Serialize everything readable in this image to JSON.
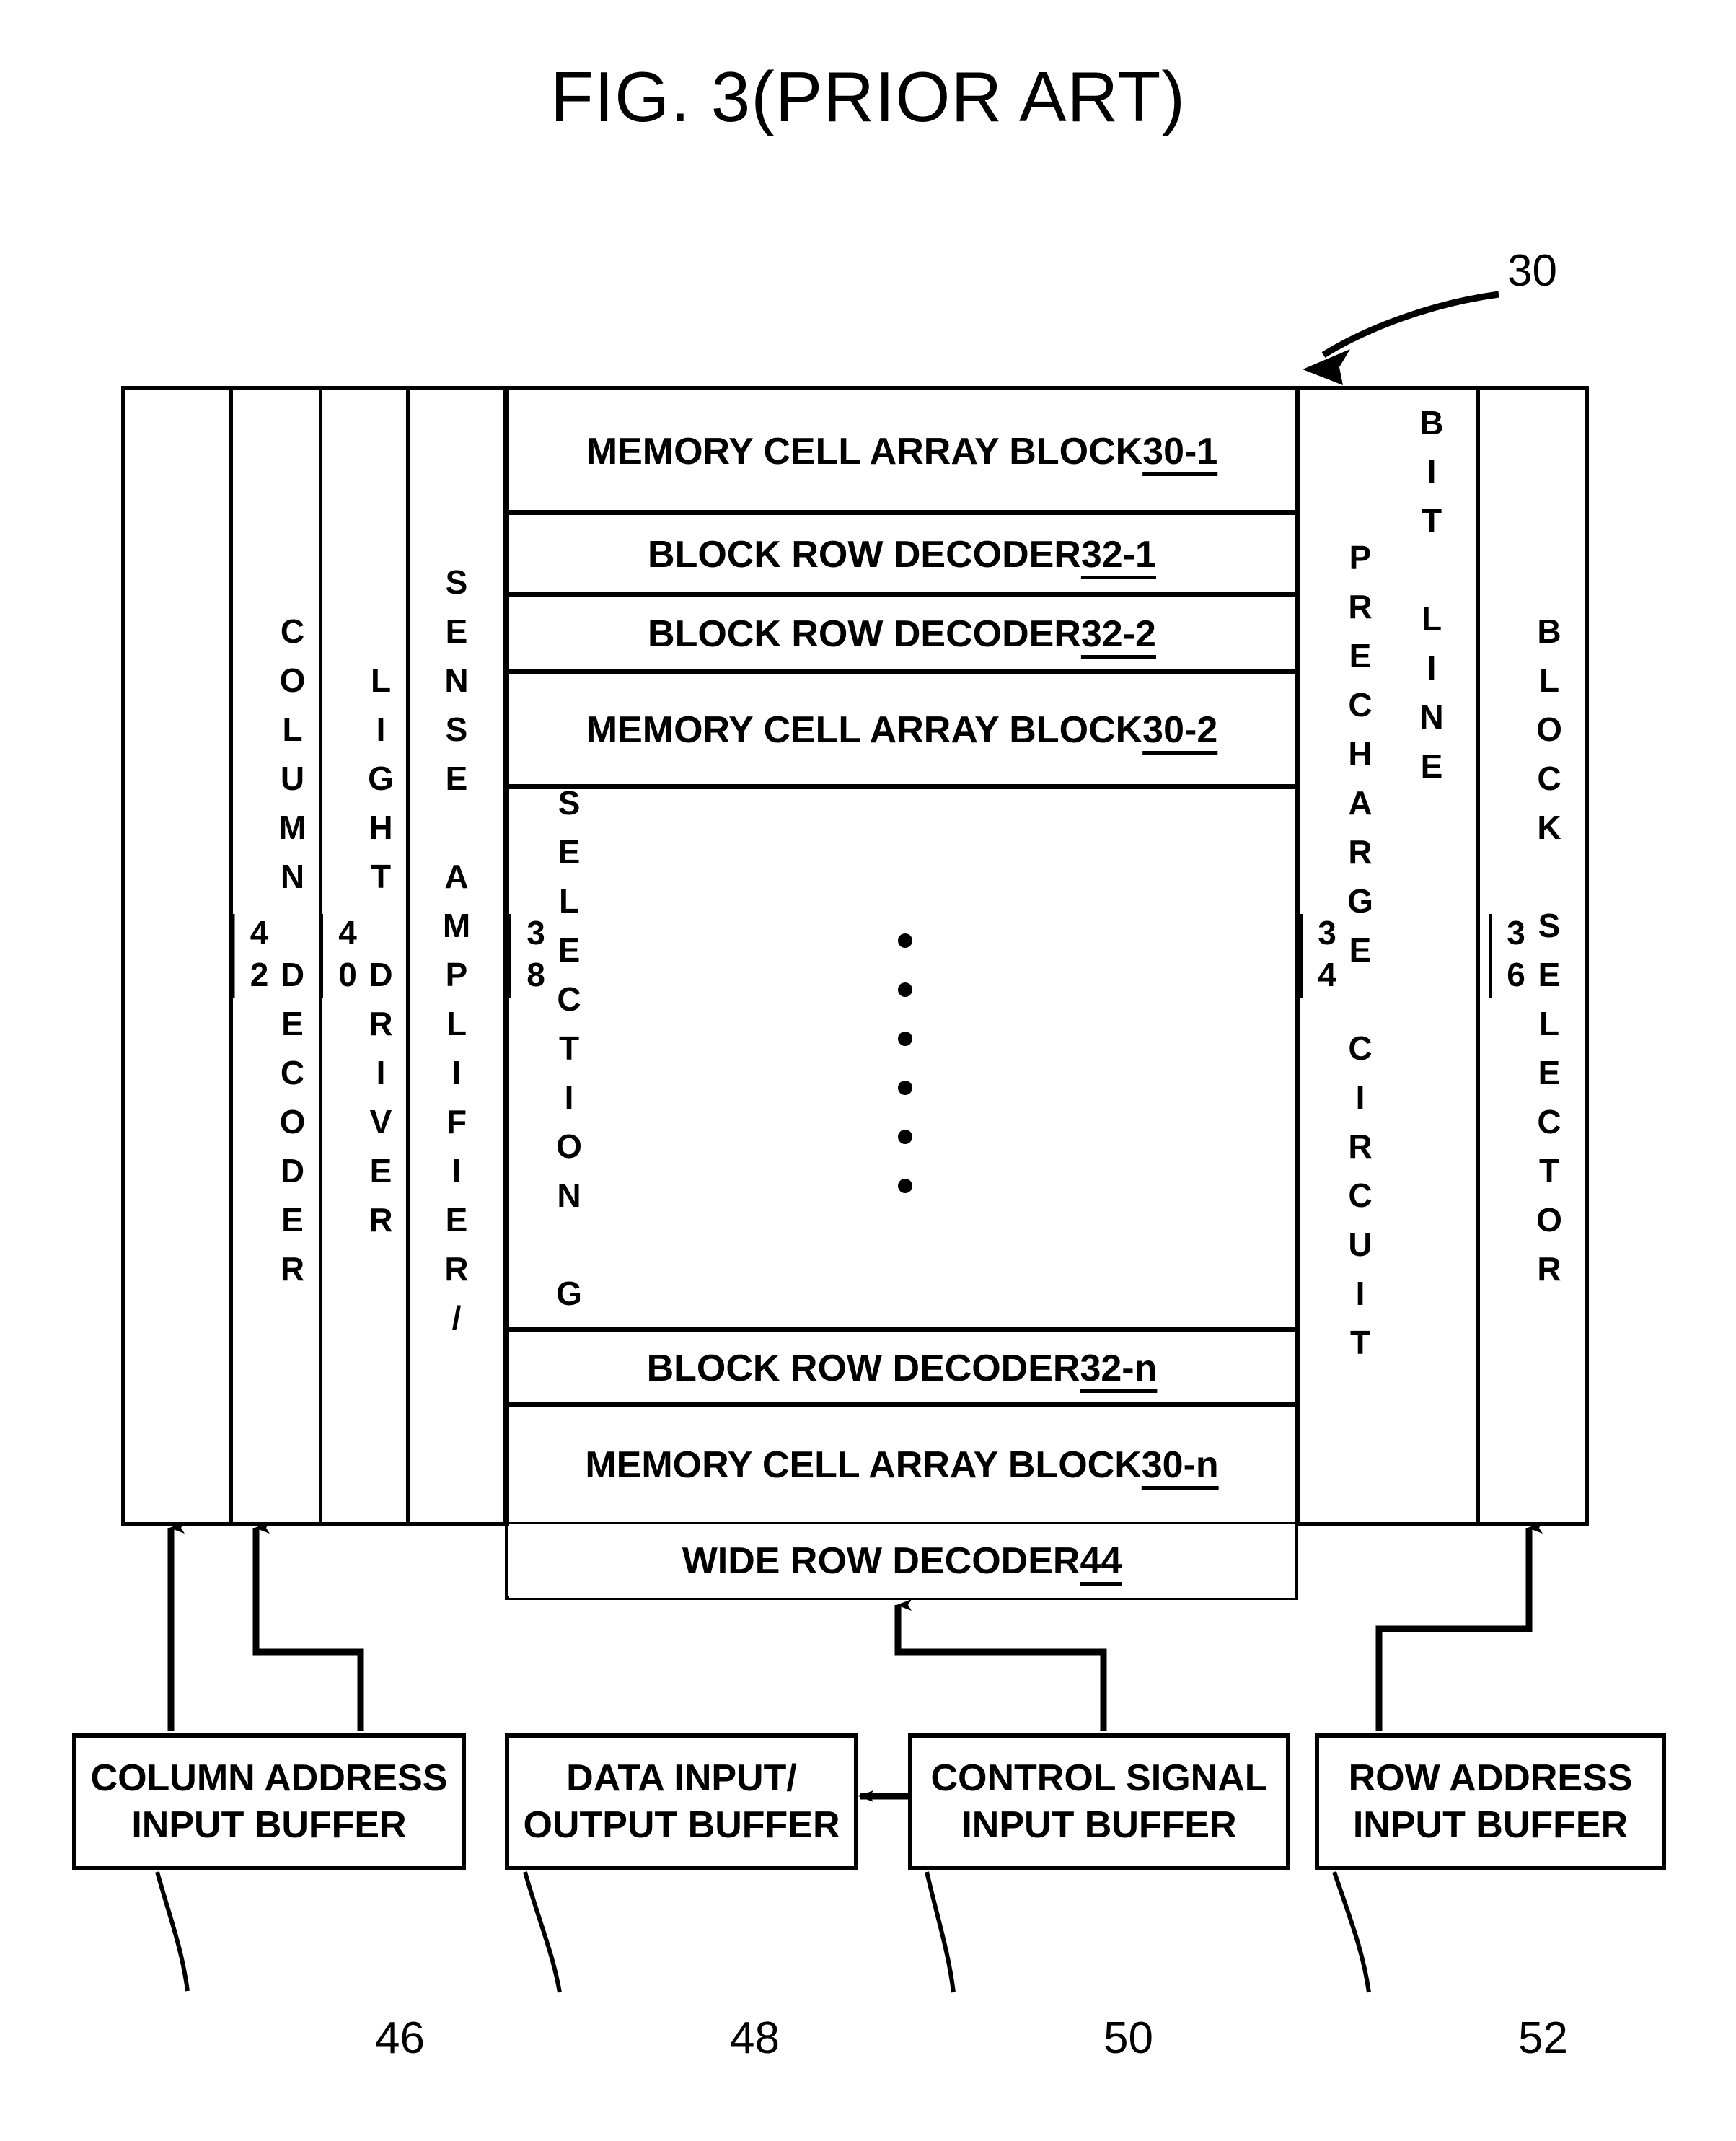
{
  "figure": {
    "title": "FIG. 3(PRIOR ART)",
    "top_reference": "30"
  },
  "left_columns": [
    {
      "name": "column-decoder",
      "label": "COLUMN DECODER",
      "ref": "42"
    },
    {
      "name": "light-driver",
      "label": "LIGHT DRIVER",
      "ref": "40"
    },
    {
      "name": "sense-amplifier",
      "label": "SENSE AMPLIFIER/",
      "ref": ""
    },
    {
      "name": "column-selection-gate",
      "label": "COLUMN SELECTION GATE",
      "ref": "38"
    }
  ],
  "right_columns": [
    {
      "name": "bit-line",
      "label": "BIT LINE",
      "ref": ""
    },
    {
      "name": "bit-line-precharge-circuit",
      "label": "PRECHARGE CIRCUIT",
      "ref": "34"
    },
    {
      "name": "block-selector",
      "label": "BLOCK SELECTOR",
      "ref": "36"
    }
  ],
  "center_rows": [
    {
      "name": "memory-cell-array-block-30-1",
      "label": "MEMORY CELL ARRAY BLOCK ",
      "ref": "30-1"
    },
    {
      "name": "block-row-decoder-32-1",
      "label": "BLOCK ROW DECODER ",
      "ref": "32-1"
    },
    {
      "name": "block-row-decoder-32-2",
      "label": "BLOCK ROW DECODER ",
      "ref": "32-2"
    },
    {
      "name": "memory-cell-array-block-30-2",
      "label": "MEMORY CELL ARRAY BLOCK ",
      "ref": "30-2"
    },
    {
      "name": "block-row-decoder-32-n",
      "label": "BLOCK ROW DECODER ",
      "ref": "32-n"
    },
    {
      "name": "memory-cell-array-block-30-n",
      "label": "MEMORY CELL ARRAY BLOCK ",
      "ref": "30-n"
    }
  ],
  "wide_row_decoder": {
    "label": "WIDE ROW DECODER ",
    "ref": "44"
  },
  "buffers": [
    {
      "name": "column-address-input-buffer",
      "line1": "COLUMN ADDRESS",
      "line2": "INPUT BUFFER",
      "ref": "46"
    },
    {
      "name": "data-input-output-buffer",
      "line1": "DATA INPUT/",
      "line2": "OUTPUT BUFFER",
      "ref": "48"
    },
    {
      "name": "control-signal-input-buffer",
      "line1": "CONTROL SIGNAL",
      "line2": "INPUT BUFFER",
      "ref": "50"
    },
    {
      "name": "row-address-input-buffer",
      "line1": "ROW ADDRESS",
      "line2": "INPUT BUFFER",
      "ref": "52"
    }
  ],
  "ellipsis": {
    "dot_count": 6
  },
  "colors": {
    "ink": "#000000",
    "paper": "#ffffff"
  }
}
